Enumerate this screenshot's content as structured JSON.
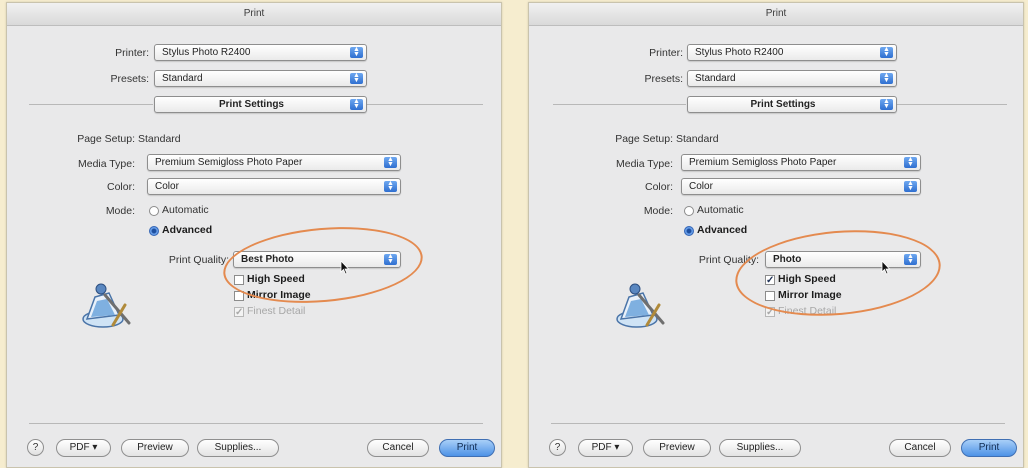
{
  "dialogs": [
    {
      "title": "Print",
      "printer_label": "Printer:",
      "printer_value": "Stylus Photo R2400",
      "presets_label": "Presets:",
      "presets_value": "Standard",
      "panel_value": "Print Settings",
      "page_setup_label": "Page Setup:",
      "page_setup_value": "Standard",
      "media_type_label": "Media Type:",
      "media_type_value": "Premium Semigloss Photo Paper",
      "color_label": "Color:",
      "color_value": "Color",
      "mode_label": "Mode:",
      "mode_automatic": "Automatic",
      "mode_advanced": "Advanced",
      "mode_selected": "Advanced",
      "print_quality_label": "Print Quality:",
      "print_quality_value": "Best Photo",
      "high_speed_label": "High Speed",
      "high_speed_checked": false,
      "mirror_image_label": "Mirror Image",
      "mirror_image_checked": false,
      "finest_detail_label": "Finest Detail",
      "finest_detail_checked": true,
      "finest_detail_enabled": false,
      "help_label": "?",
      "pdf_label": "PDF ▾",
      "preview_label": "Preview",
      "supplies_label": "Supplies...",
      "cancel_label": "Cancel",
      "print_label": "Print"
    },
    {
      "title": "Print",
      "printer_label": "Printer:",
      "printer_value": "Stylus Photo R2400",
      "presets_label": "Presets:",
      "presets_value": "Standard",
      "panel_value": "Print Settings",
      "page_setup_label": "Page Setup:",
      "page_setup_value": "Standard",
      "media_type_label": "Media Type:",
      "media_type_value": "Premium Semigloss Photo Paper",
      "color_label": "Color:",
      "color_value": "Color",
      "mode_label": "Mode:",
      "mode_automatic": "Automatic",
      "mode_advanced": "Advanced",
      "mode_selected": "Advanced",
      "print_quality_label": "Print Quality:",
      "print_quality_value": "Photo",
      "high_speed_label": "High Speed",
      "high_speed_checked": true,
      "mirror_image_label": "Mirror Image",
      "mirror_image_checked": false,
      "finest_detail_label": "Finest Detail",
      "finest_detail_checked": true,
      "finest_detail_enabled": false,
      "help_label": "?",
      "pdf_label": "PDF ▾",
      "preview_label": "Preview",
      "supplies_label": "Supplies...",
      "cancel_label": "Cancel",
      "print_label": "Print"
    }
  ],
  "colors": {
    "page_background": "#f6edcf",
    "highlight_ellipse": "#e48a4f",
    "default_button": "#4d92e6"
  }
}
